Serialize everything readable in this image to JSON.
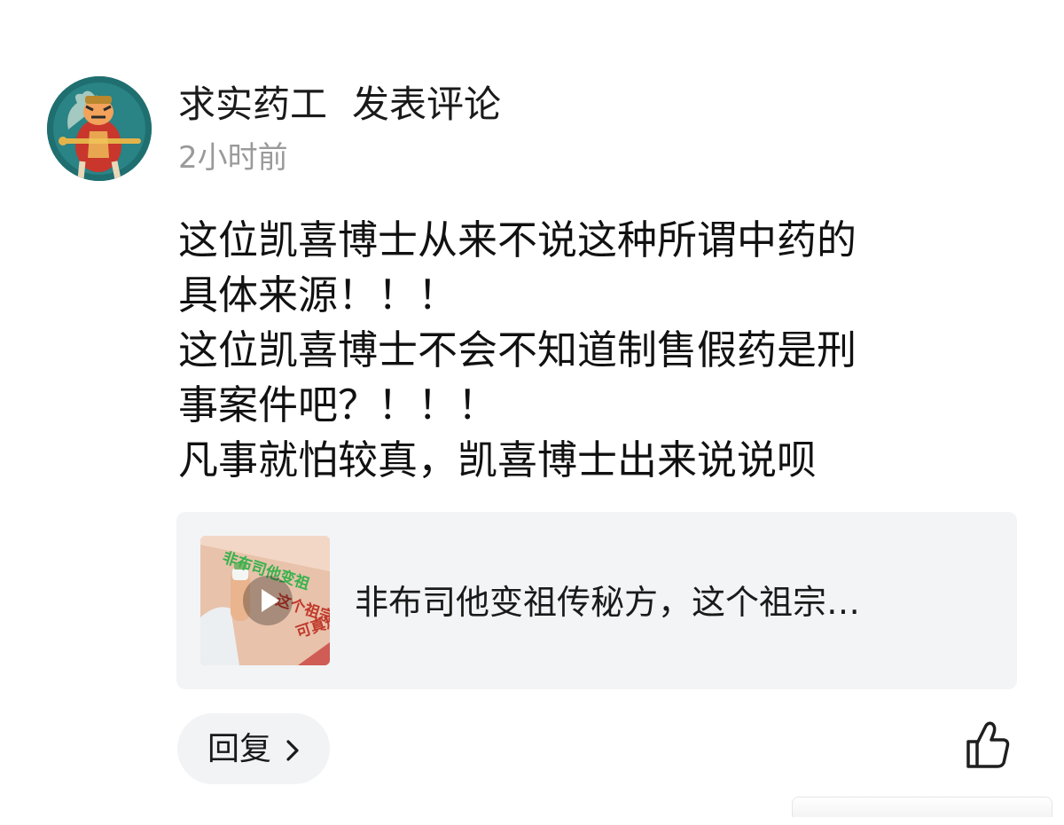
{
  "post": {
    "author": "求实药工",
    "action": "发表评论",
    "time": "2小时前",
    "content_lines": [
      "这位凯喜博士从来不说这种所谓中药的",
      "具体来源！！！",
      "这位凯喜博士不会不知道制售假药是刑",
      "事案件吧？！！！",
      "凡事就怕较真，凯喜博士出来说说呗"
    ]
  },
  "link_card": {
    "title": "非布司他变祖传秘方，这个祖宗…",
    "thumbnail_text": [
      "非布司他变祖",
      "这个祖宗",
      "可真刑！"
    ],
    "thumbnail_icon": "play-icon"
  },
  "actions": {
    "reply_label": "回复",
    "reply_icon": "chevron-right-icon",
    "like_icon": "thumbs-up-icon"
  },
  "colors": {
    "time_text": "#9a9a9a",
    "card_background": "#f3f4f6",
    "button_background": "#f2f3f5",
    "thumb_green": "#37b24d",
    "thumb_red": "#c0392b"
  }
}
